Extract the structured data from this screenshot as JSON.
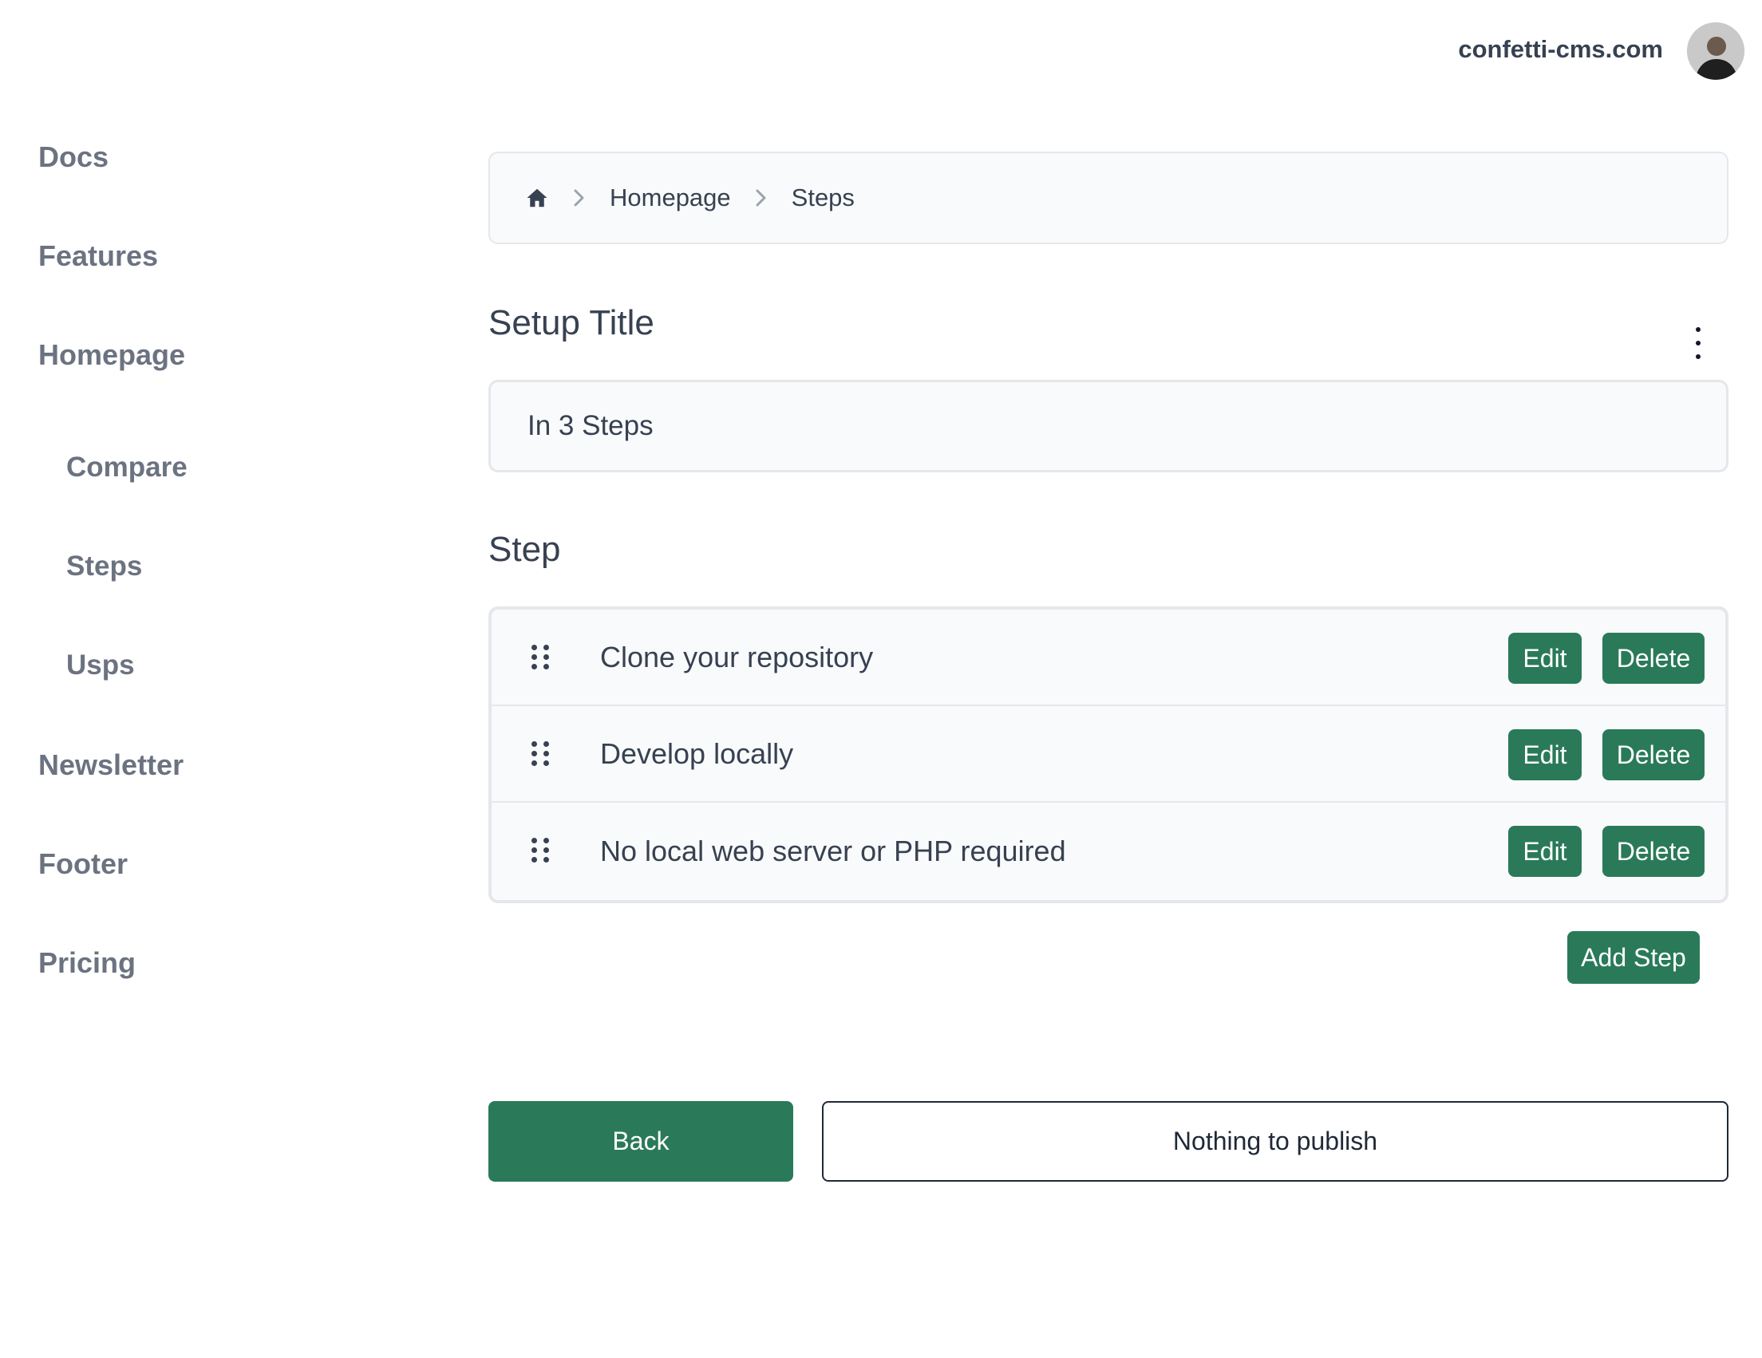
{
  "header": {
    "site_name": "confetti-cms.com",
    "avatar_icon": "user-avatar"
  },
  "sidebar": {
    "items": [
      {
        "label": "Docs"
      },
      {
        "label": "Features"
      },
      {
        "label": "Homepage"
      },
      {
        "label": "Compare"
      },
      {
        "label": "Steps"
      },
      {
        "label": "Usps"
      },
      {
        "label": "Newsletter"
      },
      {
        "label": "Footer"
      },
      {
        "label": "Pricing"
      }
    ]
  },
  "breadcrumb": {
    "home_icon": "home-icon",
    "separator_icon": "chevron-right-icon",
    "items": [
      "Homepage",
      "Steps"
    ]
  },
  "setup_title": {
    "heading": "Setup Title",
    "value": "In 3 Steps",
    "menu_icon": "kebab-menu-icon"
  },
  "steps": {
    "heading": "Step",
    "items": [
      {
        "label": "Clone your repository"
      },
      {
        "label": "Develop locally"
      },
      {
        "label": "No local web server or PHP required"
      }
    ],
    "edit_label": "Edit",
    "delete_label": "Delete",
    "add_label": "Add Step"
  },
  "footer_actions": {
    "back_label": "Back",
    "publish_label": "Nothing to publish"
  },
  "colors": {
    "accent": "#2a7a5a",
    "nav_text": "#6b7280",
    "border": "#e5e7eb",
    "panel_bg": "#f9fafb"
  }
}
